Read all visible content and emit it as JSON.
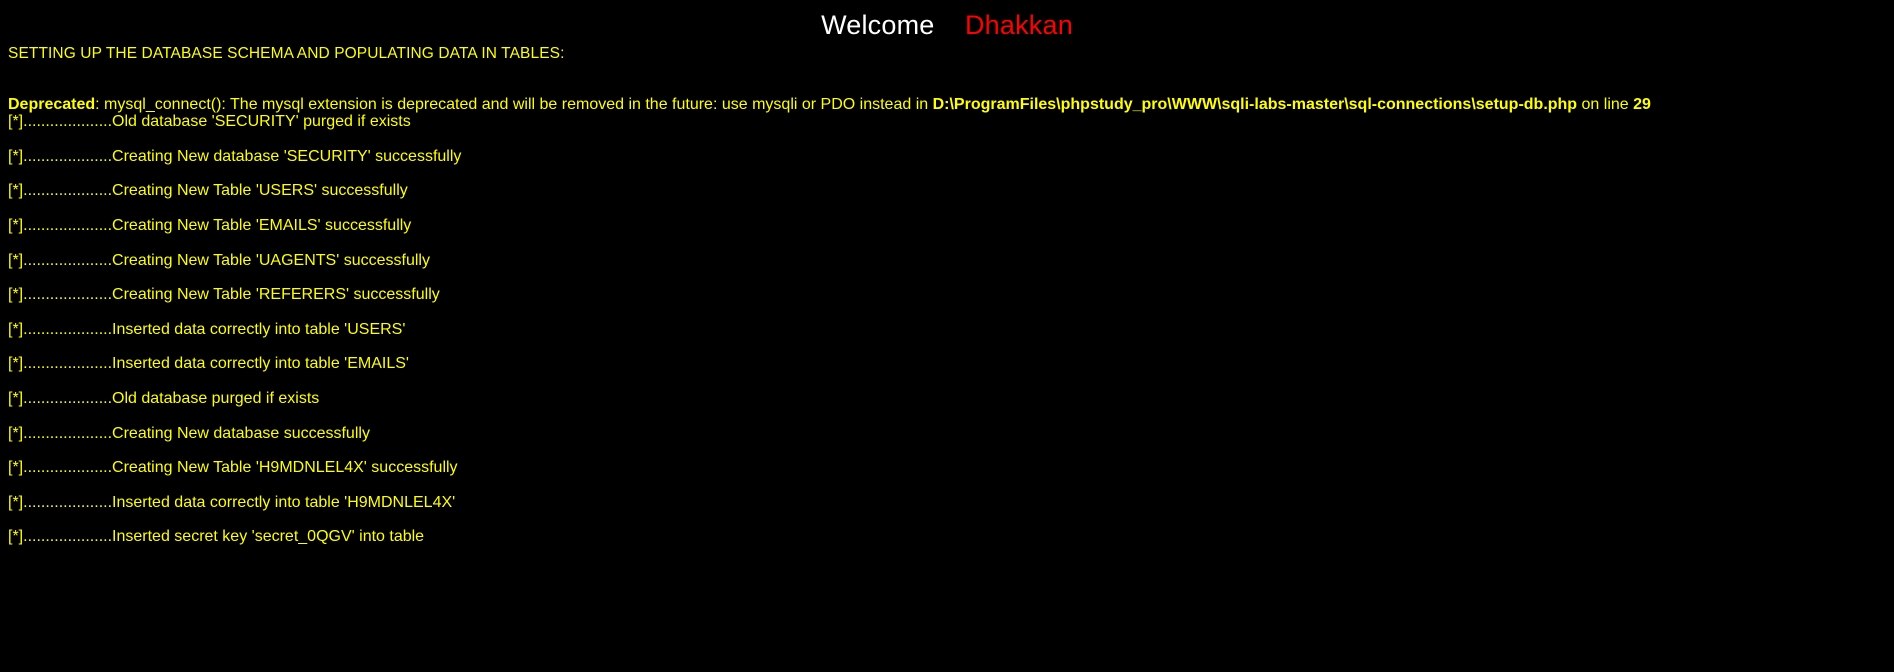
{
  "page": {
    "background_color": "#000000",
    "text_color": "#ffff00",
    "welcome_color": "#ffffff",
    "user_color": "#ff0000"
  },
  "header": {
    "welcome_label": "Welcome",
    "user_name": "Dhakkan"
  },
  "main": {
    "section_title": "SETTING UP THE DATABASE SCHEMA AND POPULATING DATA IN TABLES:",
    "warning": {
      "level_label": "Deprecated",
      "message": ": mysql_connect(): The mysql extension is deprecated and will be removed in the future: use mysqli or PDO instead in ",
      "file_path": "D:\\ProgramFiles\\phpstudy_pro\\WWW\\sqli-labs-master\\sql-connections\\setup-db.php",
      "line_prefix": " on line ",
      "line_number": "29"
    },
    "log_lines": [
      {
        "marker": "[*]",
        "dots": "....................",
        "text": "Old database 'SECURITY' purged if exists"
      },
      {
        "marker": "[*]",
        "dots": "....................",
        "text": "Creating New database 'SECURITY' successfully"
      },
      {
        "marker": "[*]",
        "dots": "....................",
        "text": "Creating New Table 'USERS' successfully"
      },
      {
        "marker": "[*]",
        "dots": "....................",
        "text": "Creating New Table 'EMAILS' successfully"
      },
      {
        "marker": "[*]",
        "dots": "....................",
        "text": "Creating New Table 'UAGENTS' successfully"
      },
      {
        "marker": "[*]",
        "dots": "....................",
        "text": "Creating New Table 'REFERERS' successfully"
      },
      {
        "marker": "[*]",
        "dots": "....................",
        "text": "Inserted data correctly into table 'USERS'"
      },
      {
        "marker": "[*]",
        "dots": "....................",
        "text": "Inserted data correctly into table 'EMAILS'"
      },
      {
        "marker": "[*]",
        "dots": "....................",
        "text": "Old database purged if exists"
      },
      {
        "marker": "[*]",
        "dots": "....................",
        "text": "Creating New database successfully"
      },
      {
        "marker": "[*]",
        "dots": "....................",
        "text": "Creating New Table 'H9MDNLEL4X' successfully"
      },
      {
        "marker": "[*]",
        "dots": "....................",
        "text": "Inserted data correctly into table 'H9MDNLEL4X'"
      },
      {
        "marker": "[*]",
        "dots": "....................",
        "text": "Inserted secret key 'secret_0QGV' into table"
      }
    ]
  }
}
